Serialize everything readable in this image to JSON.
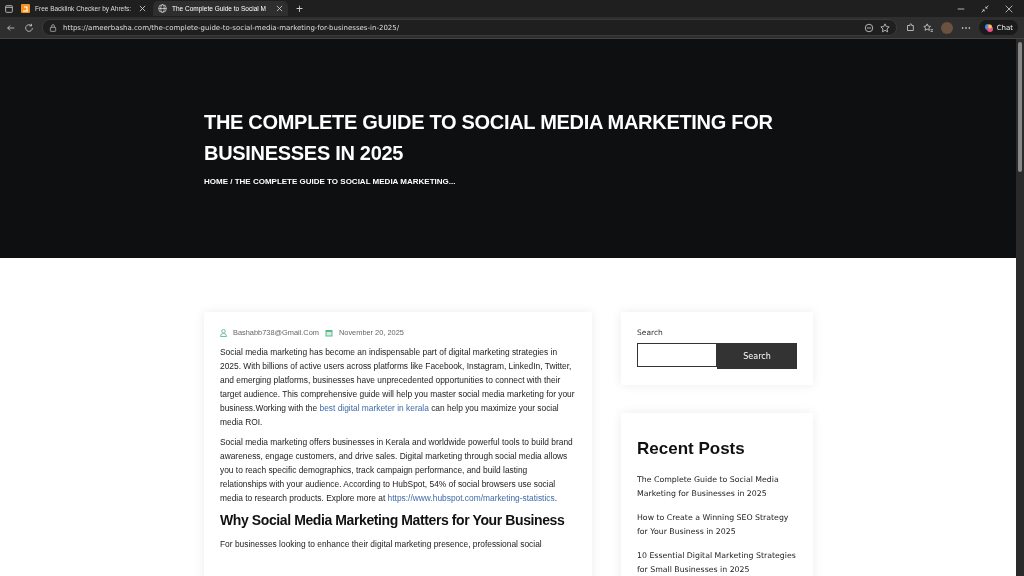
{
  "browser": {
    "tabs": [
      {
        "title": "Free Backlink Checker by Ahrefs:",
        "selected": false
      },
      {
        "title": "The Complete Guide to Social M",
        "selected": true
      }
    ],
    "new_tab": "+",
    "url": "https://ameerbasha.com/the-complete-guide-to-social-media-marketing-for-businesses-in-2025/",
    "chat": "Chat"
  },
  "hero": {
    "title": "THE COMPLETE GUIDE TO SOCIAL MEDIA MARKETING FOR BUSINESSES IN 2025",
    "breadcrumb": "HOME / THE COMPLETE GUIDE TO SOCIAL MEDIA MARKETING..."
  },
  "article": {
    "author": "Bashabb738@Gmail.Com",
    "date": "November 20, 2025",
    "paragraphs": [
      [
        {
          "text": "Social media marketing has become an indispensable part of digital marketing strategies in 2025. With billions of active users across platforms like Facebook, Instagram, LinkedIn, Twitter, and emerging platforms, businesses have unprecedented opportunities to connect with their target audience. This comprehensive guide will help you master social media marketing for your business.Working with the "
        },
        {
          "text": "best digital marketer in kerala",
          "link": true
        },
        {
          "text": " can help you maximize your social media ROI."
        }
      ],
      [
        {
          "text": "Social media marketing offers businesses in Kerala and worldwide powerful tools to build brand awareness, engage customers, and drive sales. Digital marketing through social media allows you to reach specific demographics, track campaign performance, and build lasting relationships with your audience. According to HubSpot, 54% of social browsers use social media to research products. Explore more at "
        },
        {
          "text": "https://www.hubspot.com/marketing-statistics",
          "link": true
        },
        {
          "text": "."
        }
      ]
    ],
    "heading": "Why Social Media Marketing Matters for Your Business",
    "last_paragraph": "For businesses looking to enhance their digital marketing presence, professional social"
  },
  "sidebar": {
    "search": {
      "label": "Search",
      "button": "Search"
    },
    "recent_posts": {
      "title": "Recent Posts",
      "items": [
        "The Complete Guide to Social Media Marketing for Businesses in 2025",
        "How to Create a Winning SEO Strategy for Your Business in 2025",
        "10 Essential Digital Marketing Strategies for Small Businesses in 2025"
      ]
    }
  }
}
